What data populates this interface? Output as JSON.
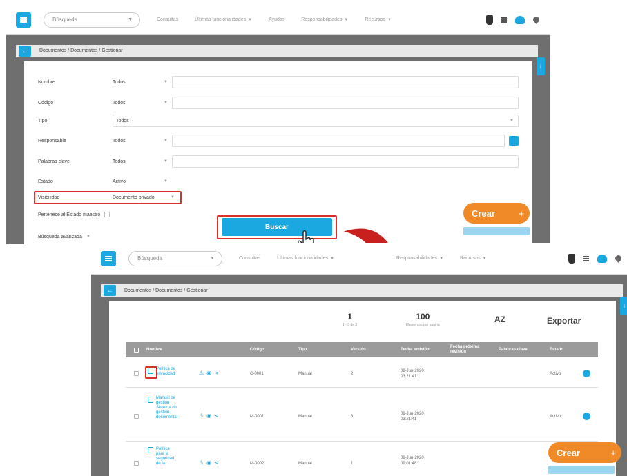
{
  "colors": {
    "accent": "#1ba8e0",
    "create": "#f08a28",
    "highlight": "#d9302a",
    "arrow": "#c8201f",
    "table_header": "#9b9b9b"
  },
  "topbar": {
    "menu_icon": "hamburger-icon",
    "search_placeholder": "Búsqueda",
    "nav": [
      "Consultas",
      "Últimas funcionalidades",
      "Ayudas",
      "Responsabilidades",
      "Recursos"
    ],
    "icons": [
      "trophy-icon",
      "list-icon",
      "people-icon",
      "pin-icon"
    ]
  },
  "breadcrumb": "Documentos / Documentos / Gestionar",
  "filters": [
    {
      "label": "Nombre",
      "op": "Todos"
    },
    {
      "label": "Código",
      "op": "Todos"
    },
    {
      "label": "Tipo",
      "op": "Todos"
    },
    {
      "label": "Responsable",
      "op": "Todos"
    },
    {
      "label": "Palabras clave",
      "op": "Todos"
    },
    {
      "label": "Estado",
      "op": "Activo"
    },
    {
      "label": "Visibilidad",
      "op": "Documento privado"
    }
  ],
  "pertenece_label": "Pertenece al Estado maestro",
  "busqueda_avanzada": "Búsqueda avanzada",
  "buscar_button": "Buscar",
  "crear_button": "Crear",
  "crear_plus": "+",
  "results": {
    "page": "1",
    "page_sub": "1 - 3 de 3",
    "per_page": "100",
    "per_page_sub": "Elementos por página",
    "sort_icon": "AZ",
    "export_label": "Exportar",
    "columns": [
      "Nombre",
      "Código",
      "Tipo",
      "Versión",
      "Fecha emisión",
      "Fecha próxima revisión",
      "Palabras clave",
      "Estado"
    ],
    "rows": [
      {
        "name": "Política de privacidad",
        "code": "C-0001",
        "type": "Manual",
        "version": "2",
        "date": "09-Jun-2020 03:21:41",
        "status": "Activo"
      },
      {
        "name": "Manual de gestión Sistema de gestión documental",
        "code": "M-0001",
        "type": "Manual",
        "version": "3",
        "date": "09-Jun-2020 03:21:41",
        "status": "Activo"
      },
      {
        "name": "Política para la seguridad de la",
        "code": "M-0002",
        "type": "Manual",
        "version": "1",
        "date": "09-Jun-2020 09:01:48",
        "status": "Activo"
      }
    ]
  }
}
